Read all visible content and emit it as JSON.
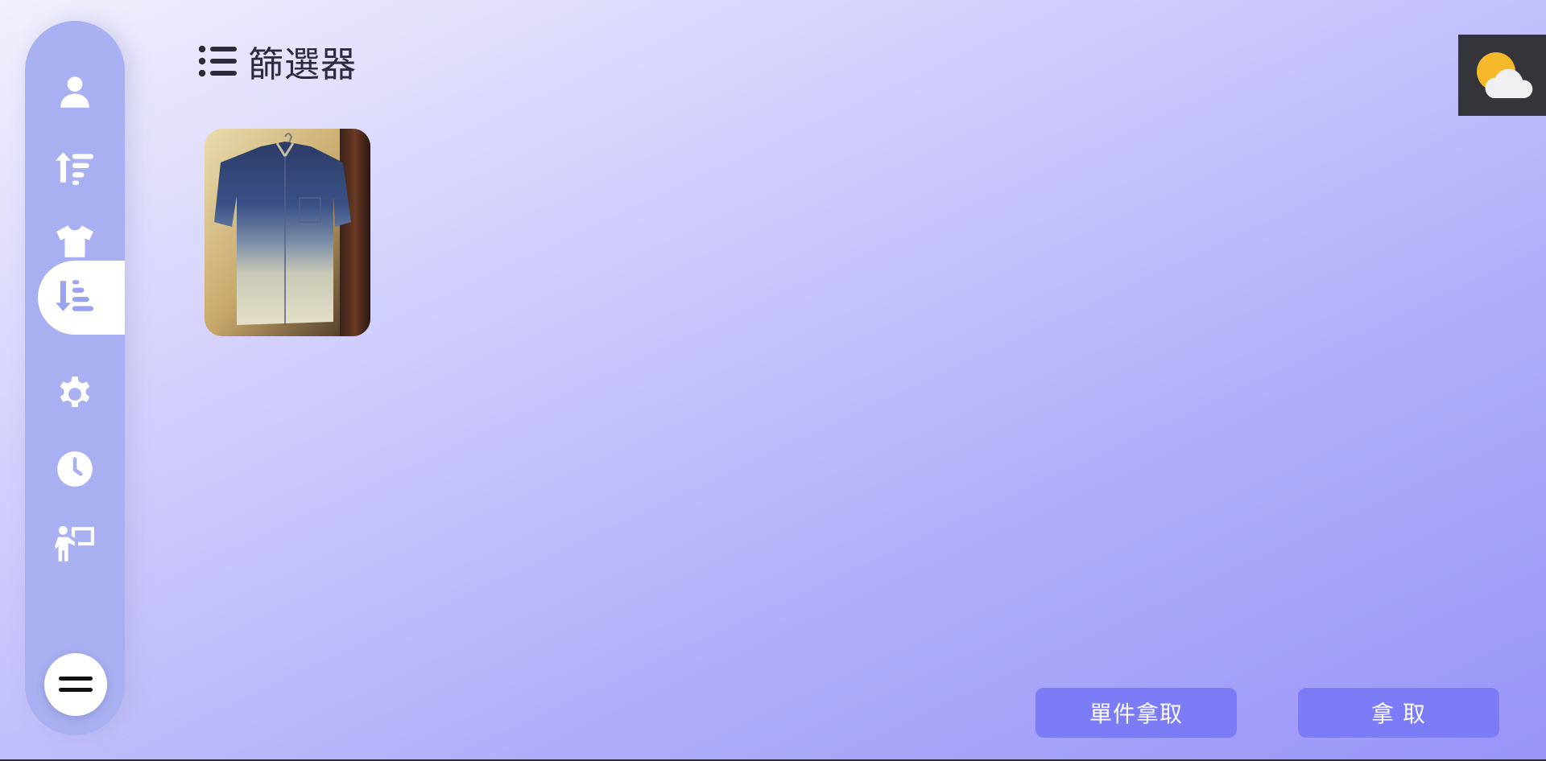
{
  "header": {
    "title": "篩選器",
    "icon": "list-icon"
  },
  "sidebar": {
    "items": [
      {
        "icon": "user-icon",
        "active": false
      },
      {
        "icon": "sort-ascending-icon",
        "active": false
      },
      {
        "icon": "tshirt-icon",
        "active": false
      },
      {
        "icon": "sort-descending-icon",
        "active": true
      },
      {
        "icon": "gear-icon",
        "active": false
      },
      {
        "icon": "clock-icon",
        "active": false
      },
      {
        "icon": "presenter-board-icon",
        "active": false
      }
    ],
    "menu_icon": "hamburger-icon"
  },
  "items": [
    {
      "type": "clothing-photo",
      "description_icon": "shirt-photo"
    }
  ],
  "weather": {
    "icon": "partly-cloudy-icon"
  },
  "actions": {
    "single_take_label": "單件拿取",
    "take_label": "拿 取"
  },
  "colors": {
    "sidebar": "#a8b0f1",
    "button": "#7c7cf7",
    "weather_bg": "#33353b"
  }
}
